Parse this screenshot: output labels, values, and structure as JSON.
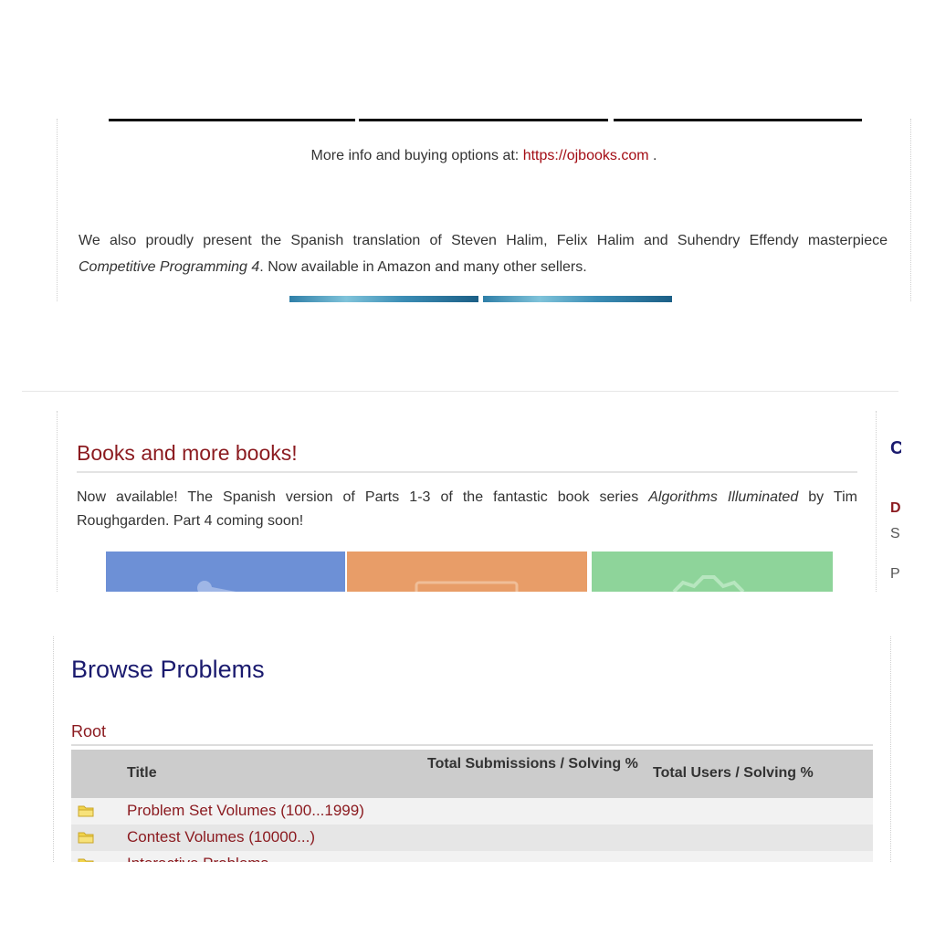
{
  "panel1": {
    "info_text": "More info and buying options at: ",
    "info_link": "https://ojbooks.com",
    "info_suffix": " .",
    "para_text_1": "We also proudly present the Spanish translation of Steven Halim, Felix Halim and Suhendry Effendy masterpiece ",
    "para_italic": "Competitive Programming 4",
    "para_text_2": ". Now available in Amazon and many other sellers."
  },
  "panel2": {
    "title": "Books and more books!",
    "para_text_1": "Now available! The Spanish version of Parts 1-3 of the fantastic book series ",
    "para_italic": "Algorithms Illuminated",
    "para_text_2": " by Tim Roughgarden. Part 4 coming soon!"
  },
  "browse": {
    "title": "Browse Problems",
    "breadcrumb": "Root",
    "columns": [
      "Title",
      "Total Submissions / Solving %",
      "Total Users / Solving %"
    ],
    "rows": [
      {
        "title": "Problem Set Volumes (100...1999)"
      },
      {
        "title": "Contest Volumes (10000...)"
      },
      {
        "title": "Interactive Problems"
      }
    ]
  },
  "colors": {
    "link_red": "#a30c14",
    "title_red": "#8b1a1f",
    "heading_navy": "#1a1a6e",
    "folder_yellow": "#f2d44a"
  },
  "icons": [
    "folder-icon"
  ]
}
